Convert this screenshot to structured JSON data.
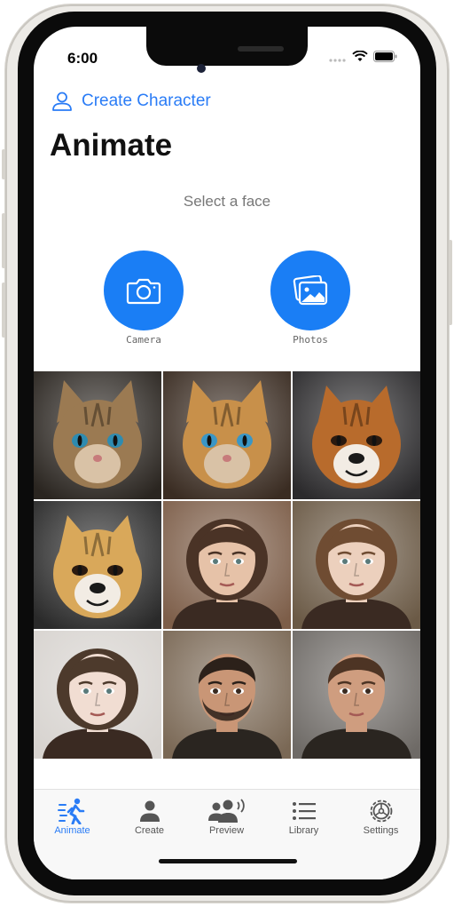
{
  "status_bar": {
    "time": "6:00"
  },
  "header": {
    "create_character_label": "Create Character",
    "title": "Animate",
    "subtitle": "Select a face"
  },
  "actions": [
    {
      "label": "Camera",
      "icon": "camera-icon"
    },
    {
      "label": "Photos",
      "icon": "photos-icon"
    }
  ],
  "faces": [
    {
      "kind": "tabby-cat",
      "bg": "#2a2520",
      "fur": "#9b7a52",
      "accent": "#2e8bb0"
    },
    {
      "kind": "orange-kitten",
      "bg": "#3a2c22",
      "fur": "#c8904a",
      "accent": "#3a96c6"
    },
    {
      "kind": "shiba-dog",
      "bg": "#2b2a2c",
      "fur": "#b86b2c",
      "accent": "#f2ece4"
    },
    {
      "kind": "shiba-dog-2",
      "bg": "#2a2a2a",
      "fur": "#d9a85a",
      "accent": "#1c1c1c"
    },
    {
      "kind": "woman-bob",
      "bg": "#7d5e49",
      "fur": "#4a3326",
      "accent": "#e6c2a8"
    },
    {
      "kind": "woman-glitter",
      "bg": "#6b5a46",
      "fur": "#6f4c32",
      "accent": "#ecd0bd"
    },
    {
      "kind": "woman-curly",
      "bg": "#d7d3cf",
      "fur": "#4d3a2c",
      "accent": "#f1ddd2"
    },
    {
      "kind": "man-beard",
      "bg": "#7a6855",
      "fur": "#2c211a",
      "accent": "#c99676"
    },
    {
      "kind": "man-young",
      "bg": "#6e6a66",
      "fur": "#4d3424",
      "accent": "#cf9d7f"
    }
  ],
  "tab_bar": {
    "active": "Animate",
    "tabs": [
      {
        "label": "Animate",
        "icon": "walking-person-icon"
      },
      {
        "label": "Create",
        "icon": "person-icon"
      },
      {
        "label": "Preview",
        "icon": "people-speaking-icon"
      },
      {
        "label": "Library",
        "icon": "list-icon"
      },
      {
        "label": "Settings",
        "icon": "gear-icon"
      }
    ]
  },
  "colors": {
    "accent": "#1a7ef5",
    "link": "#2a7cf6"
  }
}
